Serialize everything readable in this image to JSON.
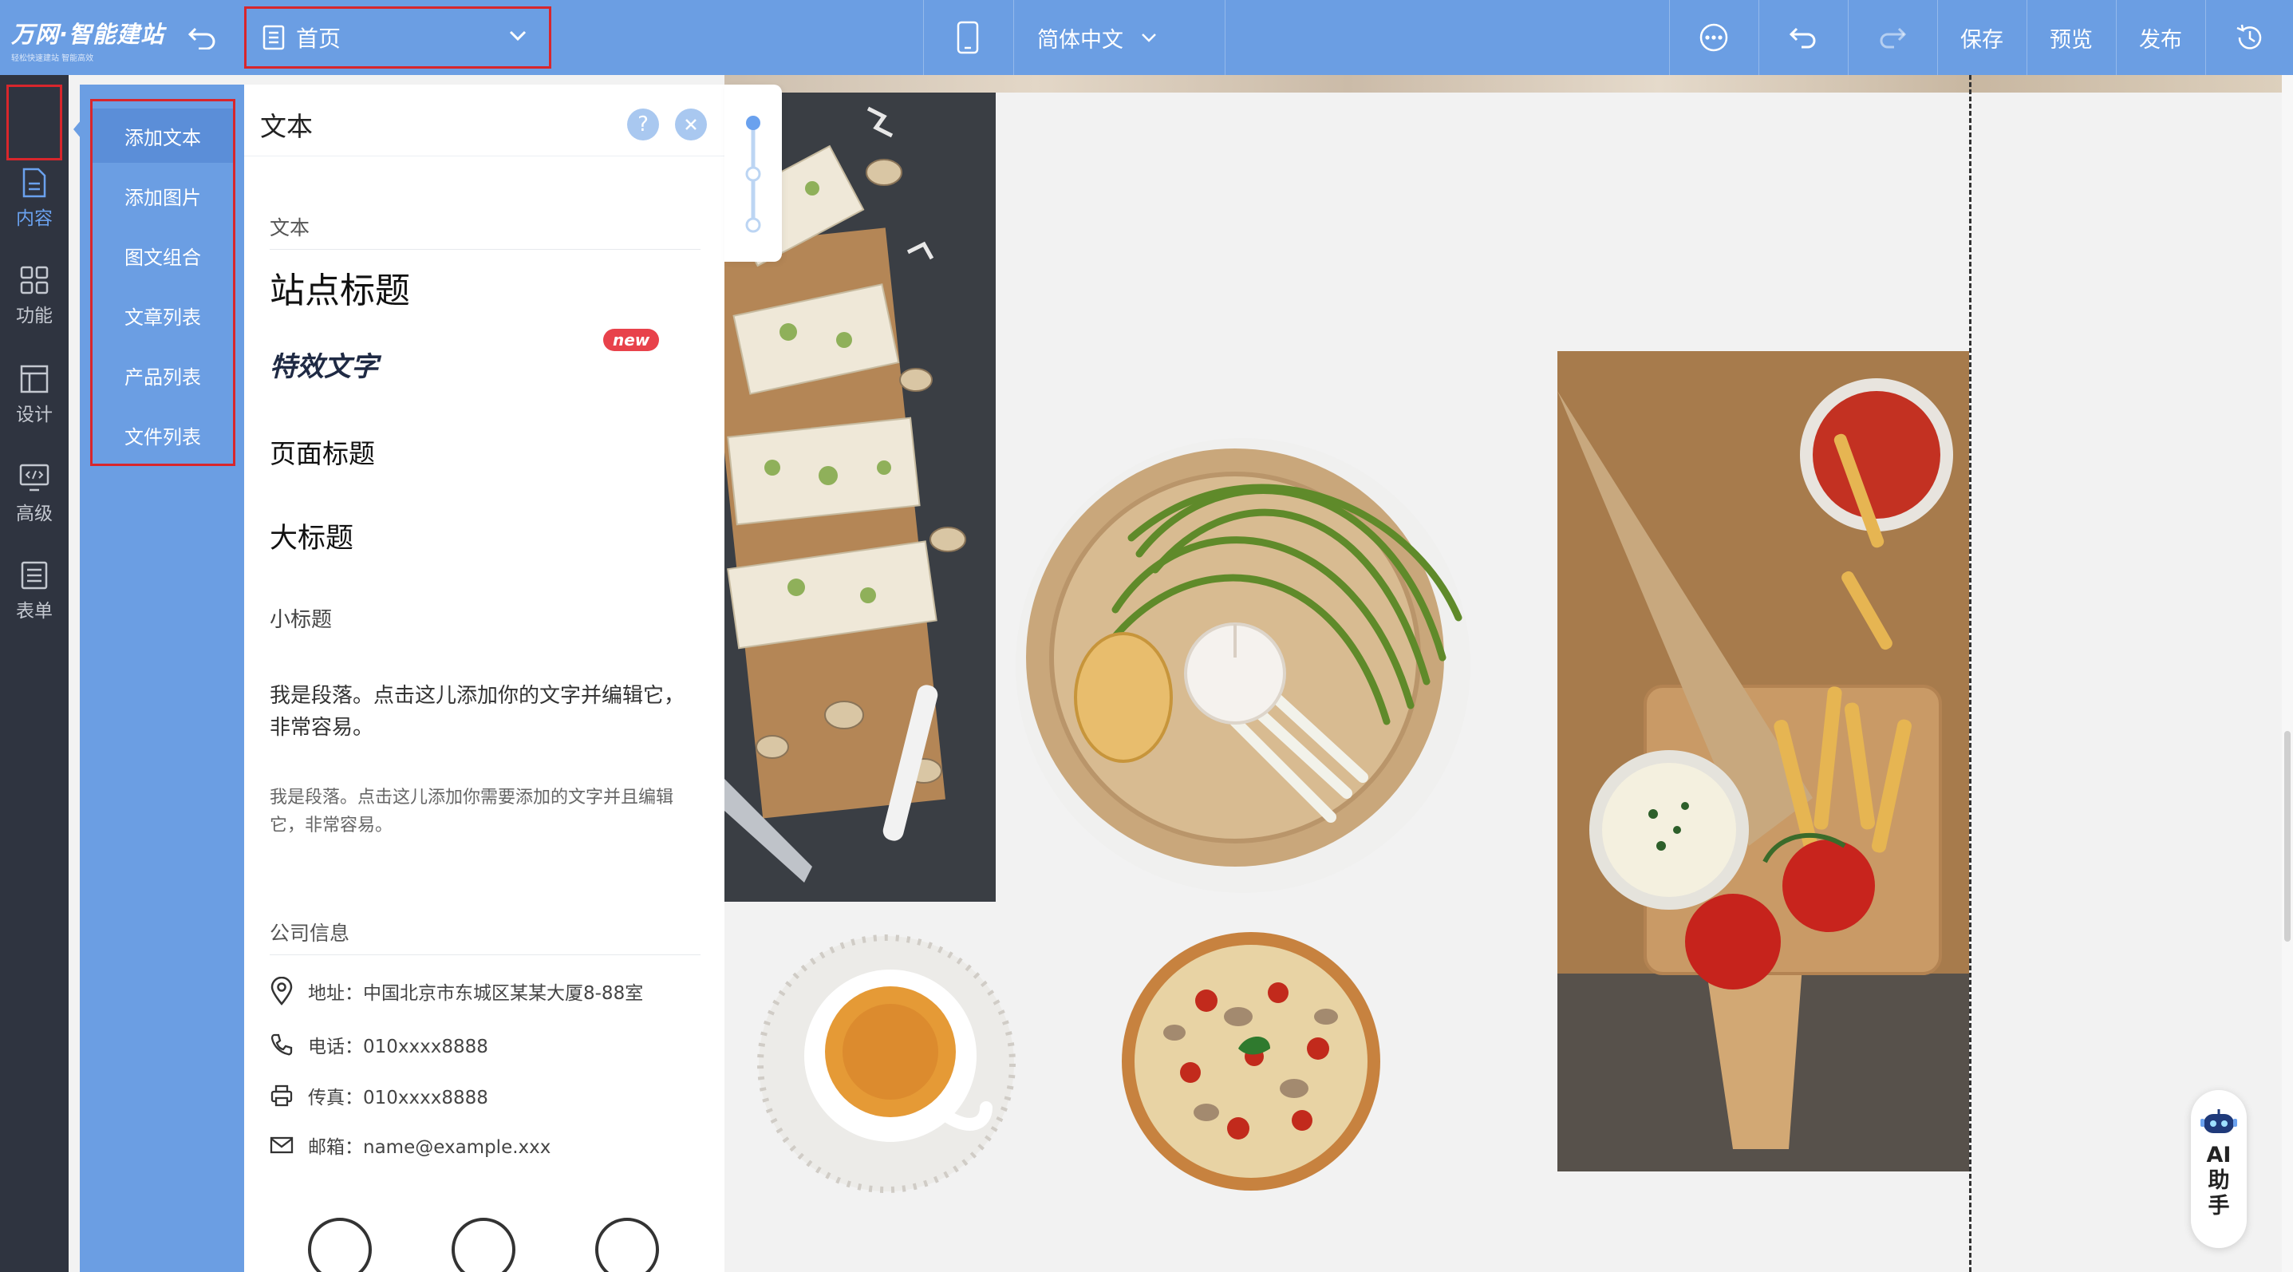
{
  "topbar": {
    "brand": "万网·智能建站",
    "slogan": "轻松快速建站 智能高效",
    "page_selector": "首页",
    "language": "简体中文",
    "save": "保存",
    "preview": "预览",
    "publish": "发布"
  },
  "rail": {
    "items": [
      {
        "label": "内容",
        "icon": "document-icon"
      },
      {
        "label": "功能",
        "icon": "grid-icon"
      },
      {
        "label": "设计",
        "icon": "layout-icon"
      },
      {
        "label": "高级",
        "icon": "code-monitor-icon"
      },
      {
        "label": "表单",
        "icon": "form-list-icon"
      }
    ]
  },
  "categories": [
    "添加文本",
    "添加图片",
    "图文组合",
    "文章列表",
    "产品列表",
    "文件列表"
  ],
  "panel": {
    "title": "文本",
    "help": "?",
    "section_text": "文本",
    "site_title": "站点标题",
    "fx_text": "特效文字",
    "new_badge": "new",
    "page_title": "页面标题",
    "big_title": "大标题",
    "small_title": "小标题",
    "paragraph1": "我是段落。点击这儿添加你的文字并编辑它，非常容易。",
    "paragraph2": "我是段落。点击这儿添加你需要添加的文字并且编辑它，非常容易。",
    "section_company": "公司信息",
    "address": "地址：中国北京市东城区某某大厦8-88室",
    "phone": "电话：010xxxx8888",
    "fax": "传真：010xxxx8888",
    "email": "邮箱：name@example.xxx"
  },
  "ai_assistant": "AI助手",
  "colors": {
    "topbar": "#6b9ee3",
    "rail": "#2f3440",
    "highlight": "#d8262c"
  }
}
